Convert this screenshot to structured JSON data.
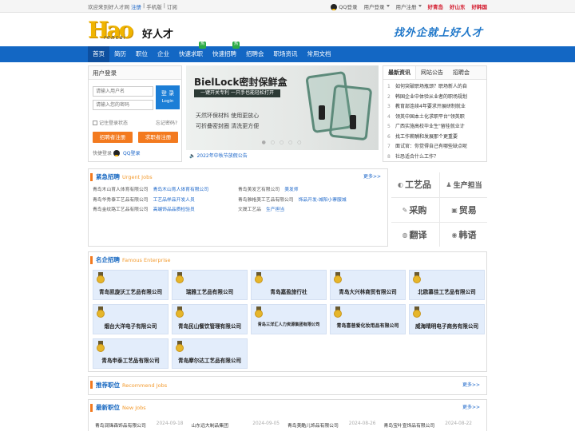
{
  "topbar": {
    "welcome": "欢迎来到好人才网",
    "register": "注册",
    "mobile": "手机版",
    "subscribe": "订阅",
    "qq_login": "QQ登录",
    "user_login": "用户登录",
    "user_register": "用户注册",
    "sites": [
      "好青岛",
      "好山东",
      "好韩国"
    ]
  },
  "header": {
    "logo_letters": "Hao",
    "logo_sub": "rencai",
    "logo_cn": "好人才",
    "slogan": "找外企就上好人才"
  },
  "nav": {
    "items": [
      {
        "label": "首页",
        "active": true
      },
      {
        "label": "简历",
        "hot": ""
      },
      {
        "label": "职位",
        "hot": ""
      },
      {
        "label": "企业",
        "hot": ""
      },
      {
        "label": "快速求职",
        "hot": "热"
      },
      {
        "label": "快速招聘",
        "hot": "热"
      },
      {
        "label": "招聘会",
        "hot": ""
      },
      {
        "label": "职场资讯",
        "hot": ""
      },
      {
        "label": "常用文档",
        "hot": ""
      }
    ]
  },
  "login": {
    "title": "用户登录",
    "username_placeholder": "请输入用户名",
    "password_placeholder": "请输入您的密码",
    "login_btn": "登 录",
    "login_btn_en": "Login",
    "remember": "记住登录状态",
    "forgot": "忘记密码?",
    "employer_reg": "招聘者注册",
    "seeker_reg": "求职者注册",
    "quick_login": "快捷登录",
    "qq_login": "QQ登录"
  },
  "banner": {
    "title": "BielLock密封保鲜盒",
    "strip": "一键开关专利 一只手也能轻松打开",
    "line1": "天然环保材料 使用更放心",
    "line2": "可折叠密封圈 清洗更方便",
    "notice": "2022年中秋节放假公告"
  },
  "news": {
    "tabs": [
      "最新资讯",
      "网站公告",
      "招聘会"
    ],
    "items": [
      "如何突破职场瓶颈？职场新人的自",
      "韩国企业中体验从业者的职场规划",
      "教育部连续4年要求开展研制就业",
      "领英中国本土化求职平台\"领英职",
      "广西实施高校毕业生\"留桂就业计",
      "找工作薪酬和发展那个更重要",
      "面试官：你觉得自己有哪些缺点呢",
      "社恐适合什么工作？"
    ]
  },
  "urgent": {
    "title": "紧急招聘",
    "title_en": "Urgent Jobs",
    "more": "更多>>",
    "rows": [
      [
        {
          "company": "青岛木山育人体育有限公司",
          "job": "青岛木山育人体育有限公司"
        },
        {
          "company": "青岛美发艺有限公司",
          "job": "美发师"
        }
      ],
      [
        {
          "company": "青岛华秀泰工艺品有限公司",
          "job": "工艺品样品开发人员"
        },
        {
          "company": "青岛雅格美工艺品有限公司",
          "job": "饰品开发-城阳小寨服城"
        }
      ],
      [
        {
          "company": "青岛金纹路工艺品有限公司",
          "job": "高端饰品品质检验员"
        },
        {
          "company": "文晟工艺品",
          "job": "生产担当"
        }
      ]
    ]
  },
  "categories": [
    {
      "icon": "◐",
      "label": "工艺品"
    },
    {
      "icon": "♟",
      "label": "生产担当"
    },
    {
      "icon": "✎",
      "label": "采购"
    },
    {
      "icon": "▣",
      "label": "贸易"
    },
    {
      "icon": "◍",
      "label": "翻译"
    },
    {
      "icon": "◉",
      "label": "韩语"
    }
  ],
  "famous": {
    "title": "名企招聘",
    "title_en": "Famous Enterprise",
    "companies": [
      "青岛凯旋沃工艺品有限公司",
      "瑞雅工艺品有限公司",
      "青岛嘉盈旅行社",
      "青岛大兴林商贸有限公司",
      "北欧慕佳工艺品有限公司",
      "烟台大洋电子有限公司",
      "青岛民山餐饮管理有限公司",
      "青岛三洋汇人力资源集团有限公司",
      "青岛喜普爱化妆用品有限公司",
      "威海晴明电子商务有限公司",
      "青岛申泰工艺品有限公司",
      "青岛摩尔达工艺品有限公司"
    ]
  },
  "recommend": {
    "title": "推荐职位",
    "title_en": "Recommend Jobs",
    "more": "更多>>"
  },
  "newjobs": {
    "title": "最新职位",
    "title_en": "New Jobs",
    "more": "更多>>",
    "items": [
      {
        "company": "青岛润锋森饰品有限公司",
        "date": "2024-09-18"
      },
      {
        "company": "山东远大制品集团",
        "date": "2024-09-05"
      },
      {
        "company": "青岛美酷儿饰品有限公司",
        "date": "2024-08-26"
      },
      {
        "company": "青岛宝叶宣饰品有限公司",
        "date": "2024-08-22"
      }
    ]
  }
}
